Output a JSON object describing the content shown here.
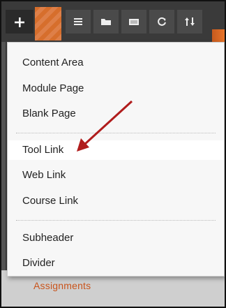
{
  "toolbar": {
    "buttons": [
      {
        "icon": "plus-icon"
      },
      {
        "icon": "list-icon"
      },
      {
        "icon": "folder-icon"
      },
      {
        "icon": "window-icon"
      },
      {
        "icon": "refresh-icon"
      },
      {
        "icon": "sort-icon"
      }
    ]
  },
  "menu": {
    "group1": [
      "Content Area",
      "Module Page",
      "Blank Page"
    ],
    "group2": [
      "Tool Link",
      "Web Link",
      "Course Link"
    ],
    "group3": [
      "Subheader",
      "Divider"
    ]
  },
  "background": {
    "course_menu_item": "Assignments"
  },
  "colors": {
    "accent_orange": "#e8742a",
    "annotation_arrow": "#b01c1c",
    "toolbar": "#3a3a3a"
  }
}
